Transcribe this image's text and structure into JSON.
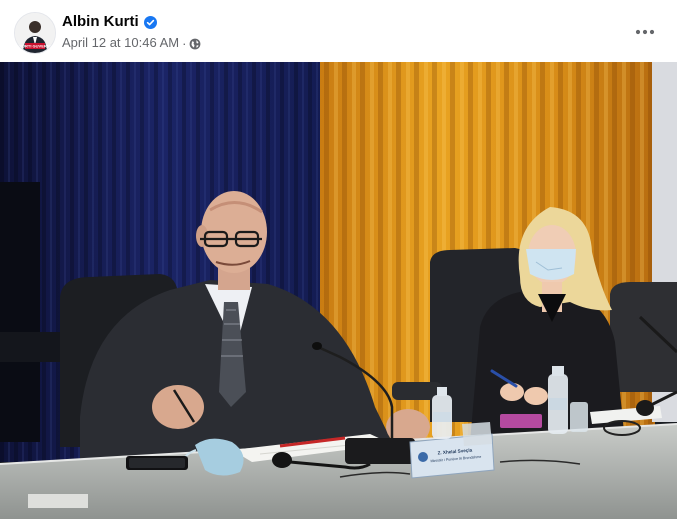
{
  "post": {
    "author": {
      "name": "Albin Kurti",
      "avatar_badge": "KURTI GUVERNI",
      "verified": true
    },
    "timestamp": "April 12 at 10:46 AM",
    "separator": "·",
    "audience_icon": "globe-icon",
    "more_icon": "more-horizontal-icon",
    "photo": {
      "nameplate_line1": "Z. Xhelal Sveçla",
      "nameplate_line2": "Ministër i Punëve të Brendshme"
    }
  },
  "colors": {
    "name_text": "#050505",
    "secondary_text": "#65676b",
    "verified_blue": "#1877f2"
  }
}
